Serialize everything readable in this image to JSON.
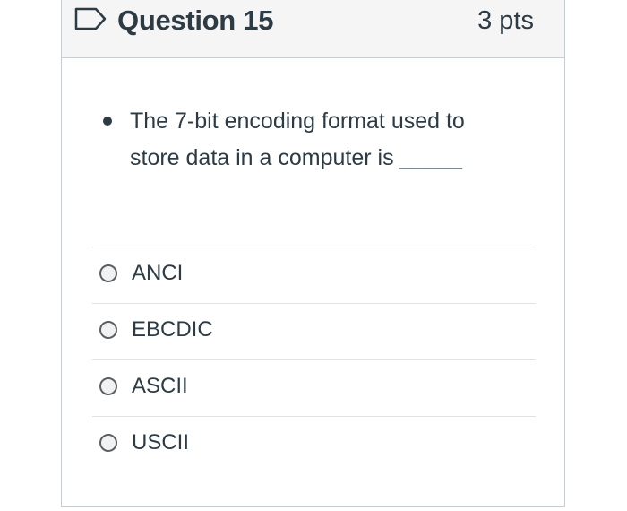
{
  "question": {
    "title": "Question 15",
    "points": "3 pts",
    "text": "The 7-bit encoding format used to store data in a computer is _____"
  },
  "answers": [
    {
      "label": "ANCI",
      "selected": false
    },
    {
      "label": "EBCDIC",
      "selected": false
    },
    {
      "label": "ASCII",
      "selected": false
    },
    {
      "label": "USCII",
      "selected": false
    }
  ],
  "icons": {
    "flag": "bookmark-flag-icon",
    "bullet": "bullet-icon",
    "radio": "radio-button-icon"
  },
  "colors": {
    "text": "#2d3b45",
    "header_bg": "#f5f5f5",
    "border": "#c7cdd1"
  }
}
